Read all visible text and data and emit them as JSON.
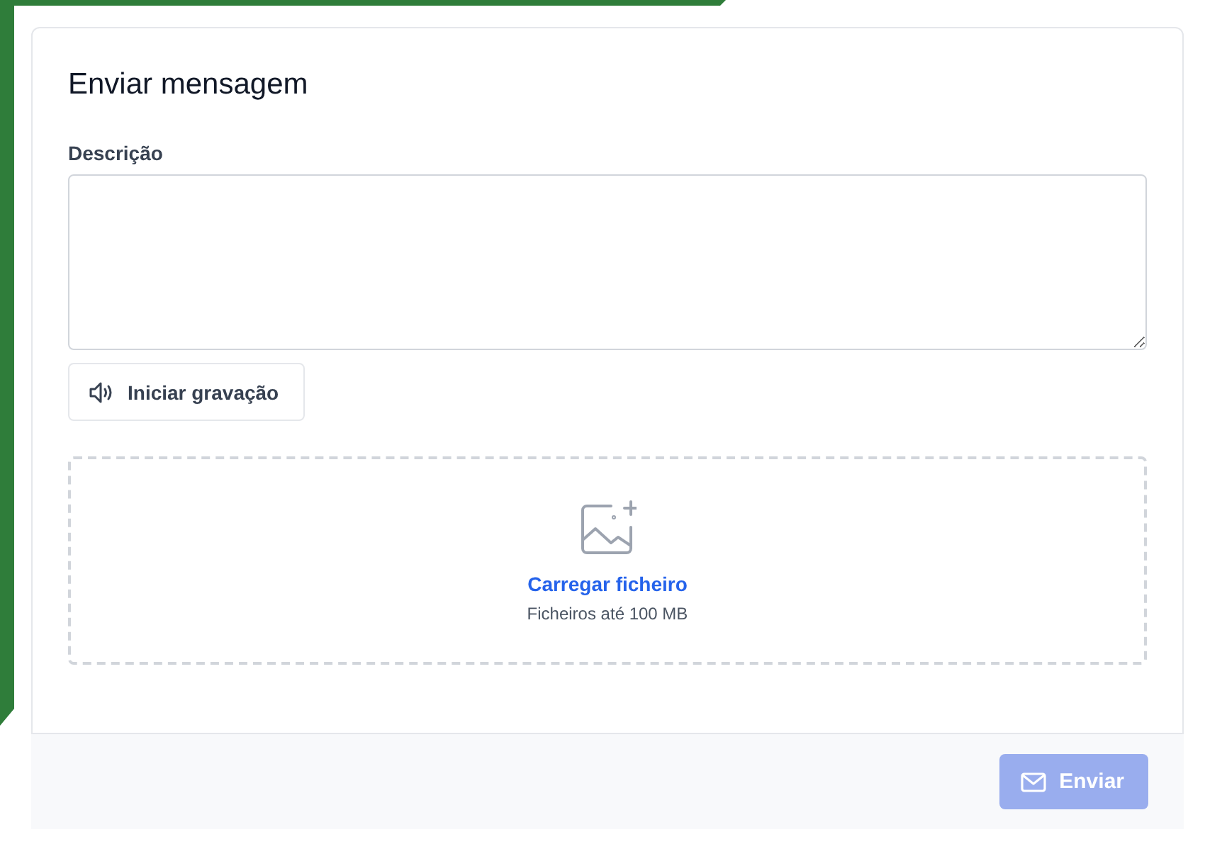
{
  "form": {
    "title": "Enviar mensagem",
    "description_label": "Descrição",
    "record_button": "Iniciar gravação",
    "upload": {
      "link": "Carregar ficheiro",
      "hint": "Ficheiros até 100 MB"
    }
  },
  "footer": {
    "send_button": {
      "label": "Enviar",
      "disabled": true
    }
  }
}
